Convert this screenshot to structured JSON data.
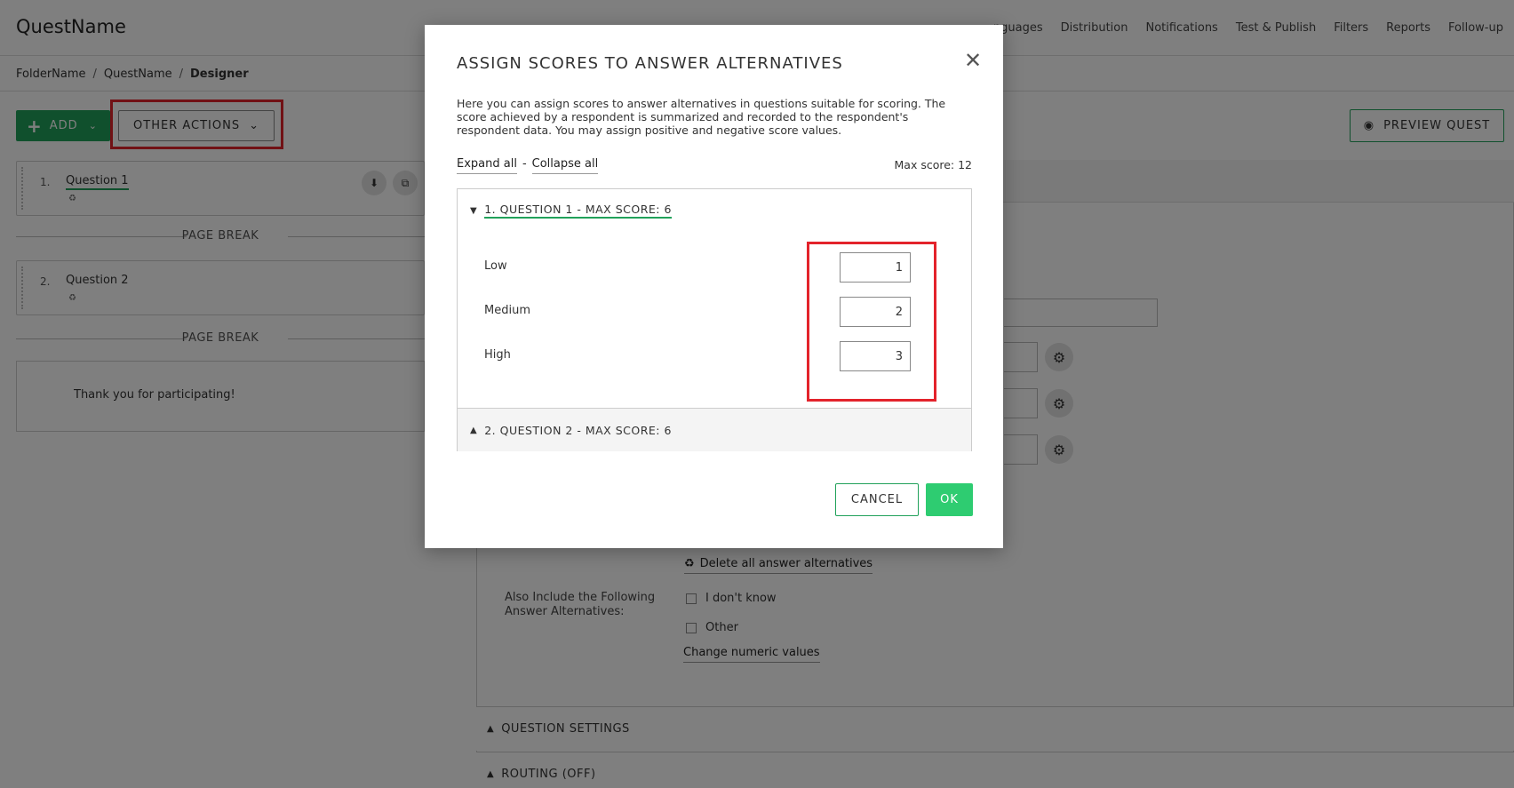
{
  "app": {
    "title": "QuestName"
  },
  "topnav": {
    "items": [
      "nguages",
      "Distribution",
      "Notifications",
      "Test & Publish",
      "Filters",
      "Reports",
      "Follow-up"
    ]
  },
  "breadcrumb": {
    "items": [
      "FolderName",
      "QuestName",
      "Designer"
    ],
    "separator": "/"
  },
  "toolbar": {
    "add_label": "ADD",
    "other_actions_label": "OTHER ACTIONS",
    "preview_label": "PREVIEW QUEST"
  },
  "questions": [
    {
      "num": "1.",
      "title": "Question 1"
    },
    {
      "num": "2.",
      "title": "Question 2"
    }
  ],
  "page_break_label": "PAGE BREAK",
  "thank_you": "Thank you for participating!",
  "editor": {
    "delete_all": "Delete all answer alternatives",
    "also_include": "Also Include the Following Answer Alternatives:",
    "dont_know": "I don't know",
    "other": "Other",
    "change_numeric": "Change numeric values",
    "question_settings": "QUESTION SETTINGS",
    "routing": "ROUTING (OFF)"
  },
  "modal": {
    "title": "ASSIGN SCORES TO ANSWER ALTERNATIVES",
    "close": "✕",
    "description": "Here you can assign scores to answer alternatives in questions suitable for scoring. The score achieved by a respondent is summarized and recorded to the respondent's respondent data. You may assign positive and negative score values.",
    "expand_all": "Expand all",
    "dash": "-",
    "collapse_all": "Collapse all",
    "max_score": "Max score: 12",
    "q1_header": "1. QUESTION 1 - MAX SCORE: 6",
    "q2_header": "2. QUESTION 2 - MAX SCORE: 6",
    "alternatives": [
      {
        "label": "Low",
        "score": "1"
      },
      {
        "label": "Medium",
        "score": "2"
      },
      {
        "label": "High",
        "score": "3"
      }
    ],
    "cancel_label": "CANCEL",
    "ok_label": "OK"
  },
  "colors": {
    "accent": "#21a15a",
    "ok": "#2ecc71",
    "highlight": "#e3232b"
  }
}
